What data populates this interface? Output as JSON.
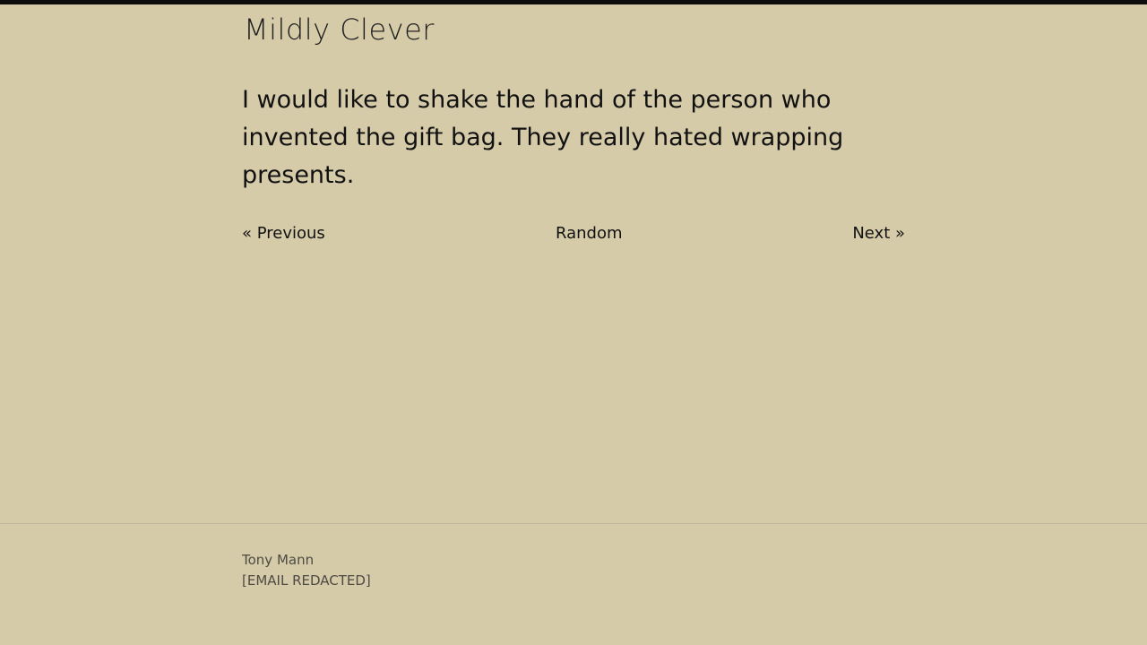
{
  "site": {
    "title": "Mildly Clever"
  },
  "joke": {
    "text": "I would like to shake the hand of the person who invented the gift bag. They really hated wrapping presents."
  },
  "nav": {
    "previous_label": "« Previous",
    "random_label": "Random",
    "next_label": "Next »"
  },
  "footer": {
    "author": "Tony Mann",
    "email": "[EMAIL REDACTED]"
  },
  "colors": {
    "background": "#d6cba9",
    "top_bar": "#0d0d0d",
    "text": "#111111",
    "footer_text": "#4d4a44"
  }
}
